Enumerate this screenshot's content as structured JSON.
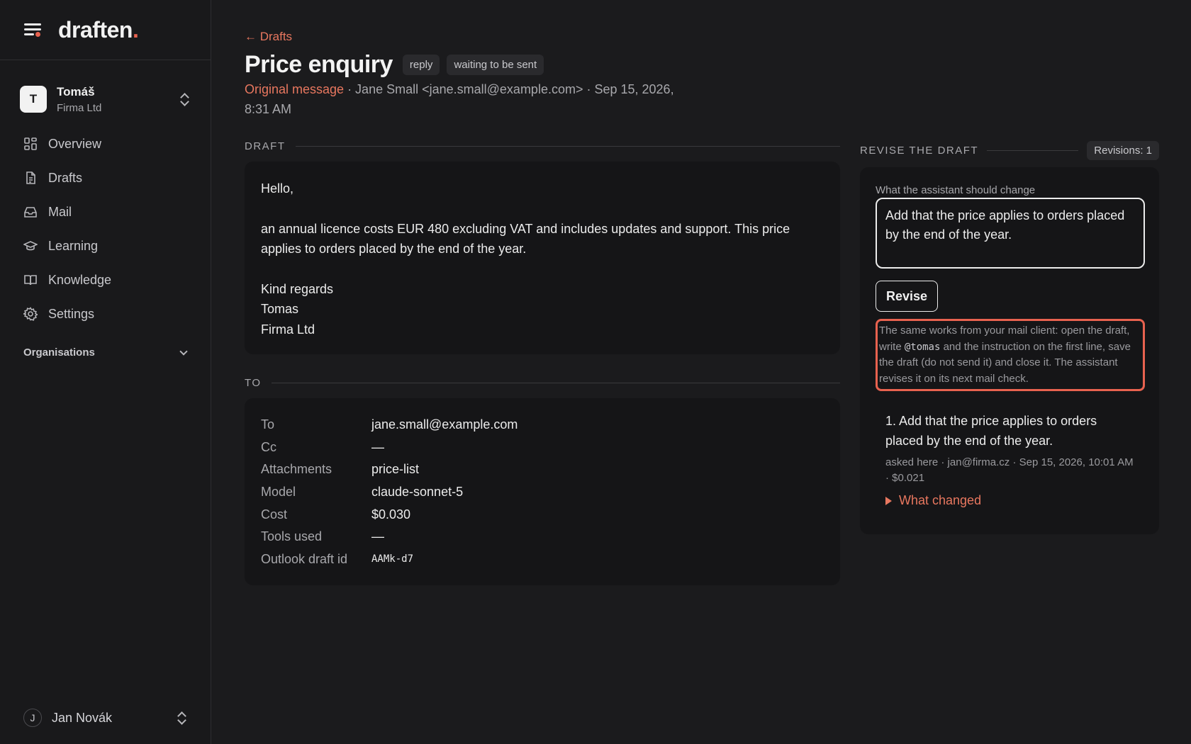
{
  "app": {
    "name": "draften",
    "dot": "."
  },
  "account": {
    "initial": "T",
    "name": "Tomáš",
    "org": "Firma Ltd"
  },
  "nav": {
    "items": [
      {
        "label": "Overview",
        "icon": "grid-icon"
      },
      {
        "label": "Drafts",
        "icon": "document-icon"
      },
      {
        "label": "Mail",
        "icon": "inbox-icon"
      },
      {
        "label": "Learning",
        "icon": "graduation-cap-icon"
      },
      {
        "label": "Knowledge",
        "icon": "book-icon"
      },
      {
        "label": "Settings",
        "icon": "gear-icon"
      }
    ],
    "organisations": "Organisations"
  },
  "user": {
    "initial": "J",
    "name": "Jan Novák"
  },
  "page": {
    "back": "← Drafts",
    "title": "Price enquiry",
    "chips": [
      "reply",
      "waiting to be sent"
    ],
    "original_link": "Original message",
    "meta": " · Jane Small <jane.small@example.com> · Sep 15, 2026, 8:31 AM"
  },
  "draft": {
    "label": "DRAFT",
    "greeting": "Hello,",
    "body": "an annual licence costs EUR 480 excluding VAT and includes updates and support. This price applies to orders placed by the end of the year.",
    "closing": "Kind regards",
    "name": "Tomas",
    "company": "Firma Ltd"
  },
  "to": {
    "label": "TO",
    "rows": [
      {
        "k": "To",
        "v": "jane.small@example.com"
      },
      {
        "k": "Cc",
        "v": "—"
      },
      {
        "k": "Attachments",
        "v": "price-list"
      },
      {
        "k": "Model",
        "v": "claude-sonnet-5"
      },
      {
        "k": "Cost",
        "v": "$0.030"
      },
      {
        "k": "Tools used",
        "v": "—"
      },
      {
        "k": "Outlook draft id",
        "v": "AAMk-d7"
      }
    ]
  },
  "revise": {
    "label": "REVISE THE DRAFT",
    "revisions": "Revisions: 1",
    "field_label": "What the assistant should change",
    "value": "Add that the price applies to orders placed by the end of the year.",
    "button": "Revise",
    "hint_before": "The same works from your mail client: open the draft, write ",
    "hint_code": "@tomas",
    "hint_after": " and the instruction on the first line, save the draft (do not send it) and close it. The assistant revises it on its next mail check.",
    "entry_text": "1. Add that the price applies to orders placed by the end of the year.",
    "entry_info": "asked here · jan@firma.cz · Sep 15, 2026, 10:01 AM · $0.021",
    "what_changed": "What changed"
  },
  "colors": {
    "accent": "#e8624f",
    "link": "#e8775f",
    "background": "#1b1b1d",
    "card": "#151517"
  }
}
